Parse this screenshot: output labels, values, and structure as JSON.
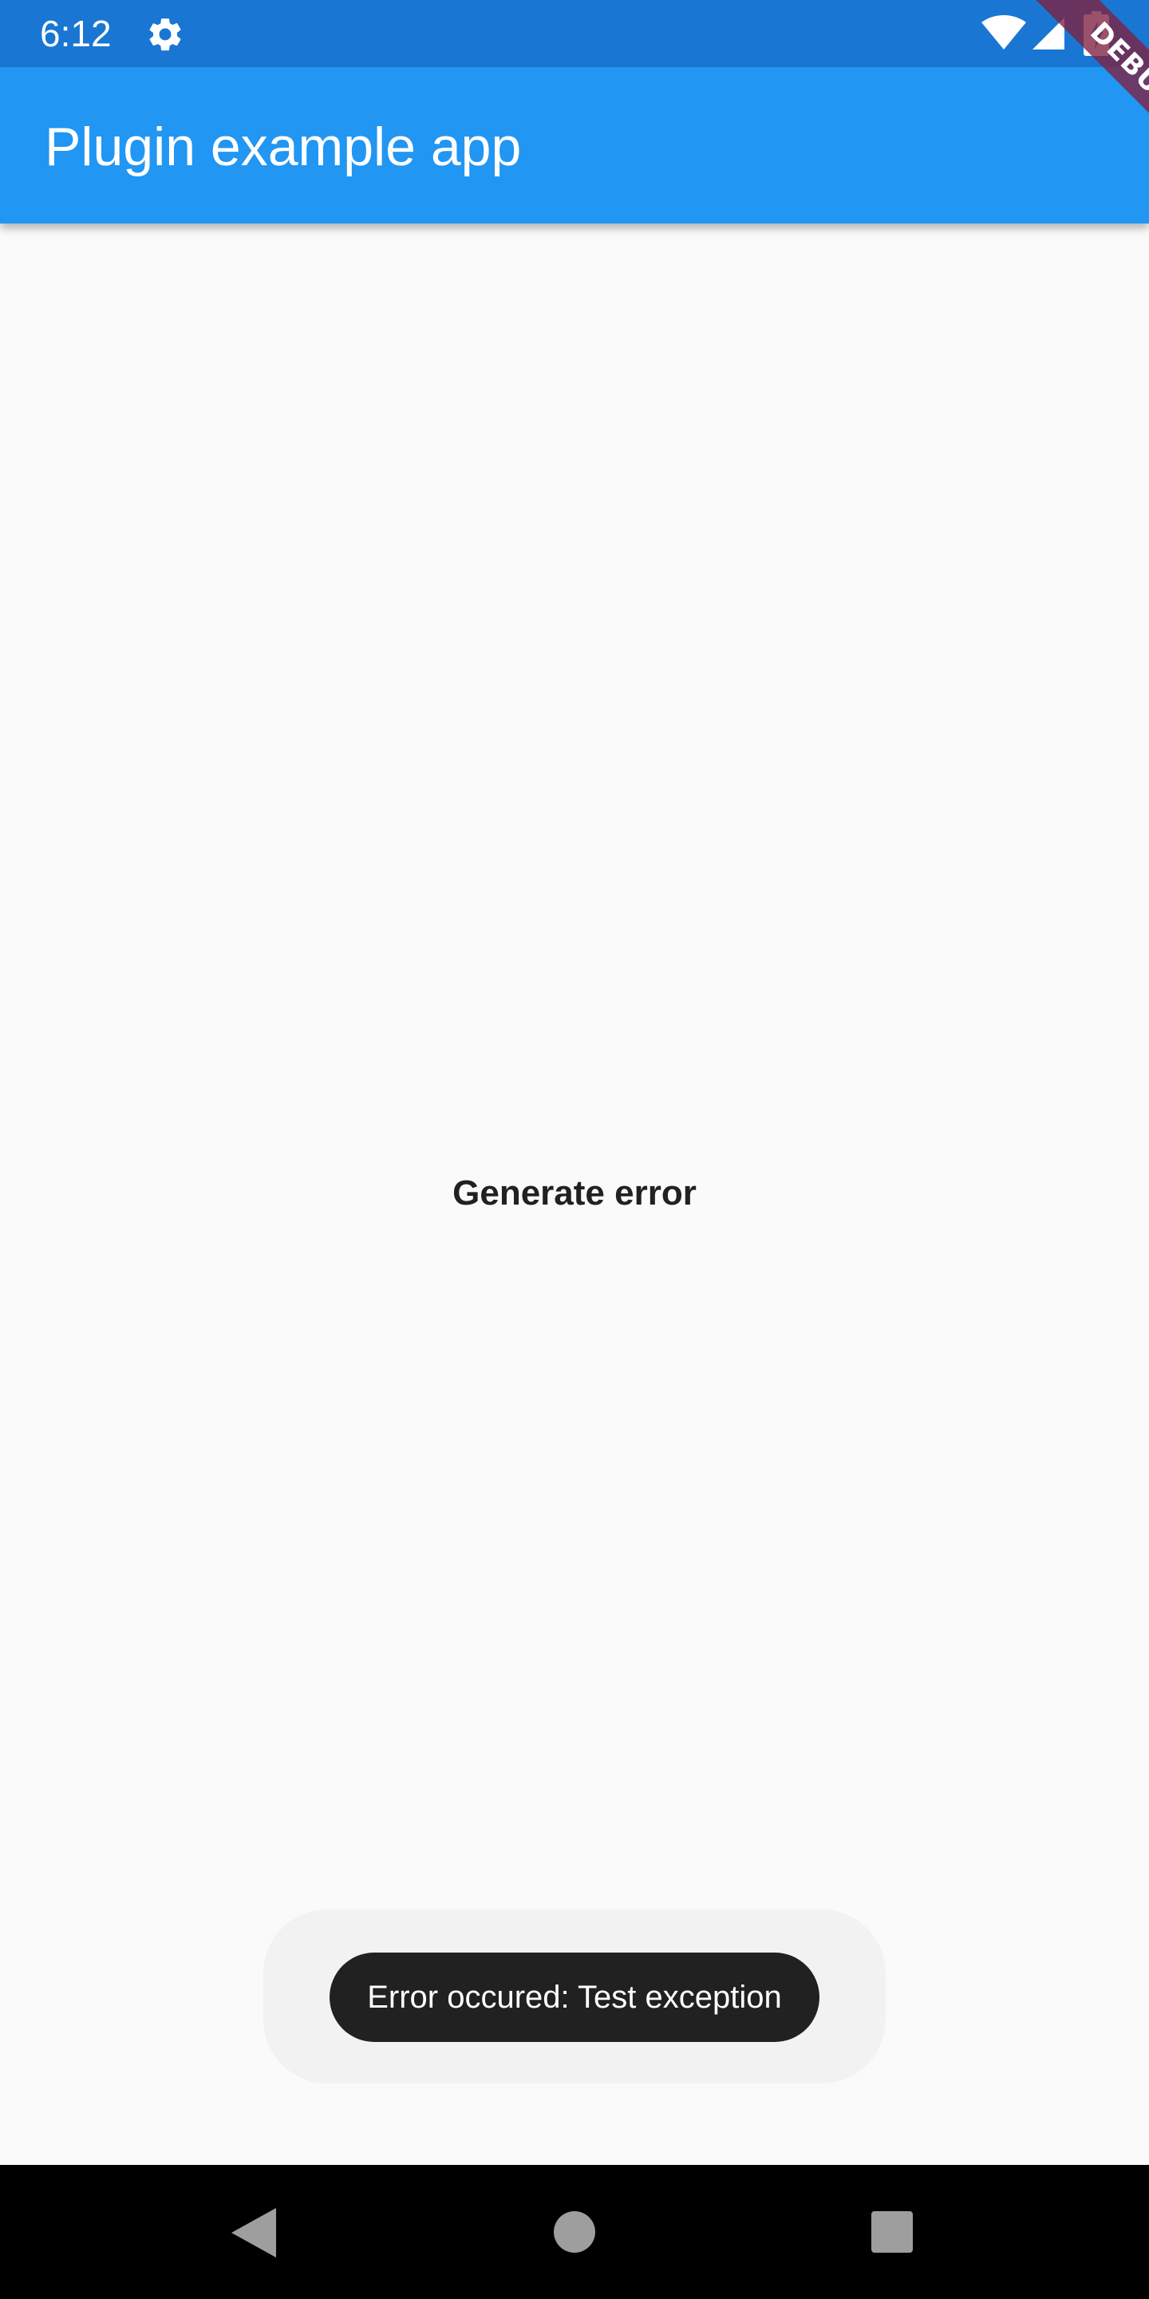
{
  "status_bar": {
    "time": "6:12",
    "icons": [
      "settings-gear-icon",
      "wifi-icon",
      "cell-signal-icon",
      "battery-charging-icon"
    ]
  },
  "app_bar": {
    "title": "Plugin example app",
    "color": "#2196f3"
  },
  "debug_banner": {
    "label": "DEBUG"
  },
  "main": {
    "generate_button_label": "Generate error"
  },
  "toast": {
    "message": "Error occured: Test exception"
  },
  "nav_bar": {
    "icons": [
      "back-icon",
      "home-icon",
      "recents-icon"
    ]
  },
  "colors": {
    "status_bar": "#1976d2",
    "app_bar": "#2196f3",
    "background": "#fafafa",
    "toast": "#212121",
    "nav_bar": "#000000",
    "debug_banner": "#802040"
  }
}
